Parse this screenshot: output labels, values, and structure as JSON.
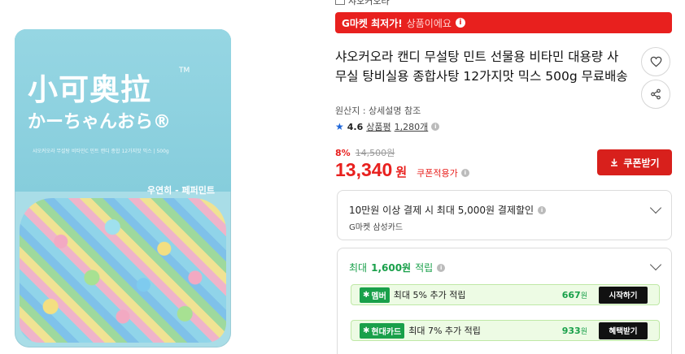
{
  "product_image": {
    "brand_title": "小可奥拉",
    "brand_tm": "TM",
    "brand_sub": "かーちゃんおら®",
    "desc": "샤오커오라 무설탕 비타민C 민트 캔디 종합 12가지맛 믹스 | 500g",
    "tag": "우연히 - 페퍼민트"
  },
  "shop": {
    "name": "샤오커오라"
  },
  "banner": {
    "strong": "G마켓 최저가!",
    "light": "상품이에요"
  },
  "product": {
    "title": "샤오커오라 캔디 무설탕 민트 선물용 비타민 대용량 사무실 탕비실용 종합사탕 12가지맛 믹스 500g 무료배송",
    "origin": "원산지 : 상세설명 참조",
    "rating": "4.6",
    "review_label": "상품평",
    "review_count": "1,280개"
  },
  "price": {
    "discount_pct": "8%",
    "original": "14,500원",
    "final": "13,340",
    "won": "원",
    "coupon_note": "쿠폰적용가"
  },
  "buttons": {
    "coupon": "쿠폰받기"
  },
  "card_offer": {
    "line1": "10만원 이상 결제 시 최대 5,000원 결제할인",
    "line2": "G마켓 삼성카드"
  },
  "points": {
    "prefix": "최대",
    "amount": "1,600원",
    "suffix": "적립",
    "benefits": [
      {
        "badge": "멤버",
        "text": "최대 5% 추가 적립",
        "amount": "667",
        "unit": "원",
        "action": "시작하기"
      },
      {
        "badge": "현대카드",
        "text": "최대 7% 추가 적립",
        "amount": "933",
        "unit": "원",
        "action": "혜택받기"
      }
    ]
  },
  "colors": {
    "accent_red": "#e8201e",
    "green": "#19a04a",
    "bag_blue": "#96d6e3"
  },
  "icons": [
    "home-icon",
    "info-icon",
    "heart-icon",
    "share-icon",
    "star-icon",
    "download-icon",
    "chevron-down-icon",
    "g-logo-icon"
  ]
}
